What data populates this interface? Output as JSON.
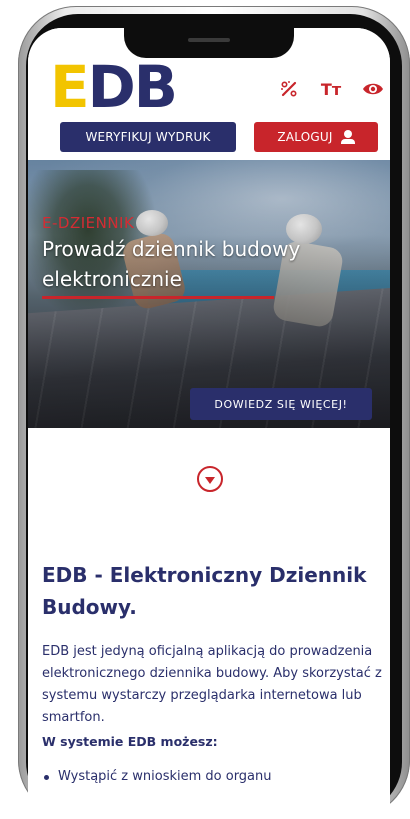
{
  "header": {
    "logo_e": "E",
    "logo_db": "DB",
    "tools": {
      "contrast_icon": "contrast-icon",
      "font_size_label": "Tт",
      "visibility_icon": "eye-icon"
    },
    "verify_button": "WERYFIKUJ WYDRUK",
    "login_button": "ZALOGUJ"
  },
  "hero": {
    "kicker": "E-DZIENNIK",
    "title": "Prowadź dziennik budowy elektronicznie",
    "cta": "DOWIEDZ SIĘ WIĘCEJ!"
  },
  "content": {
    "scroll_icon": "chevron-down-circle-icon",
    "section_title": "EDB - Elektroniczny Dziennik Budowy.",
    "intro": "EDB jest jedyną oficjalną aplikacją do prowadzenia elektronicznego dziennika budowy. Aby skorzystać z systemu wystarczy przeglądarka internetowa lub smartfon.",
    "subheading": "W systemie EDB możesz:",
    "list": [
      "Wystąpić z wnioskiem do organu"
    ]
  },
  "colors": {
    "navy": "#2a2f6b",
    "red": "#c8252b",
    "yellow": "#f2c400"
  }
}
